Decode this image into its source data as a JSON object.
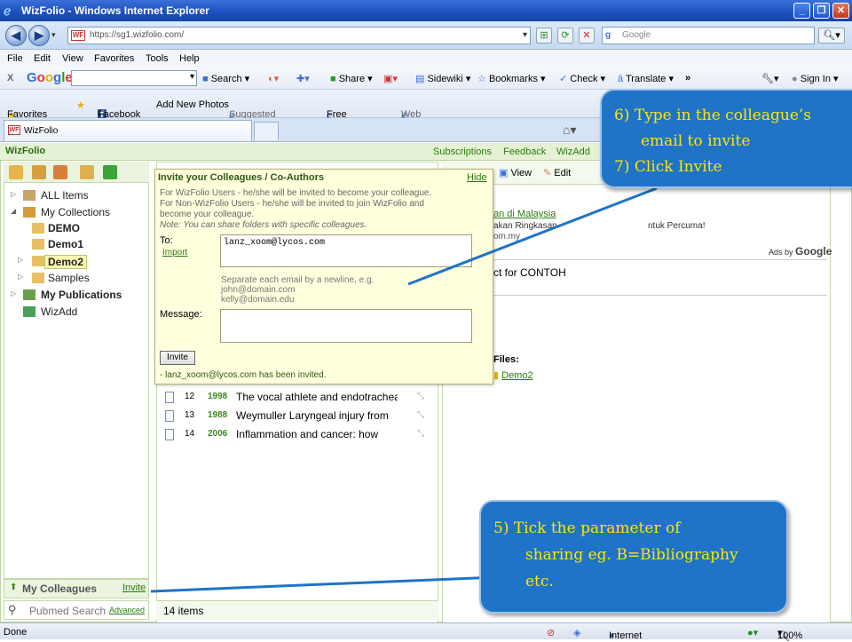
{
  "window": {
    "title": "WizFolio - Windows Internet Explorer"
  },
  "browser": {
    "url": "https://sg1.wizfolio.com/",
    "search_placeholder": "Google",
    "menu": [
      "File",
      "Edit",
      "View",
      "Favorites",
      "Tools",
      "Help"
    ],
    "google_toolbar": {
      "logo": "Google",
      "items": [
        "Search ▾",
        "Share ▾",
        "Sidewiki ▾",
        "Bookmarks ▾",
        "Check ▾",
        "Translate ▾",
        "»",
        "Sign In ▾"
      ]
    },
    "favorites": {
      "label": "Favorites",
      "items": [
        "Facebook",
        "Add New Photos",
        "Suggested Sites ▾",
        "Free Hotmail",
        "Web Slice Gallery ▾"
      ]
    },
    "tab_label": "WizFolio",
    "status": {
      "left": "Done",
      "zone": "Internet",
      "zoom": "100%"
    }
  },
  "app": {
    "brand": "WizFolio",
    "top_links": [
      "Subscriptions",
      "Feedback",
      "WizAdd"
    ],
    "tree": [
      {
        "label": "ALL Items",
        "bold": false
      },
      {
        "label": "My Collections",
        "bold": false
      },
      {
        "label": "DEMO",
        "bold": true
      },
      {
        "label": "Demo1",
        "bold": true
      },
      {
        "label": "Demo2",
        "bold": true
      },
      {
        "label": "Samples",
        "bold": false
      },
      {
        "label": "My Publications",
        "bold": true
      },
      {
        "label": "WizAdd",
        "bold": false
      }
    ],
    "colleagues_label": "My Colleagues",
    "invite_link": "Invite",
    "pubmed_placeholder": "Pubmed Search",
    "advanced_link": "Advanced",
    "items_count": "14 items",
    "rows": [
      {
        "num": "12",
        "year": "1998",
        "title": "The vocal athlete and endotracheal"
      },
      {
        "num": "13",
        "year": "1988",
        "title": "Weymuller Laryngeal injury from"
      },
      {
        "num": "14",
        "year": "2006",
        "title": "Inflammation and cancer: how"
      }
    ],
    "right_panel": {
      "tools": [
        "View",
        "Edit"
      ],
      "ad_title": "an di Malaysia",
      "ad_line1": "akan Ringkasan",
      "ad_line1b": "ntuk Percuma!",
      "ad_line2": "om.my",
      "ads_by": "Ads by",
      "ads_google": "Google",
      "contoh": "ct for CONTOH",
      "files_label": "Files:",
      "files_link": "Demo2"
    }
  },
  "dialog": {
    "title": "Invite your Colleagues / Co-Authors",
    "hide": "Hide",
    "notes": [
      "For WizFolio Users - he/she will be invited to become your colleague.",
      "For Non-WizFolio Users - he/she will be invited to join WizFolio and",
      "become your colleague.",
      "Note: You can share folders with specific colleagues."
    ],
    "to_label": "To:",
    "import_link": "Import",
    "to_value": "lanz_xoom@lycos.com",
    "separator_hint": [
      "Separate each email by a newline, e.g.",
      "john@domain.com",
      "kelly@domain.edu"
    ],
    "message_label": "Message:",
    "invite_button": "Invite",
    "invited_message": "- lanz_xoom@lycos.com has been invited."
  },
  "callouts": {
    "top": [
      "6)   Type in the colleague’s",
      "email to invite",
      "7)   Click Invite"
    ],
    "bottom": [
      "5)    Tick the parameter of",
      "sharing eg. B=Bibliography",
      "etc."
    ]
  }
}
